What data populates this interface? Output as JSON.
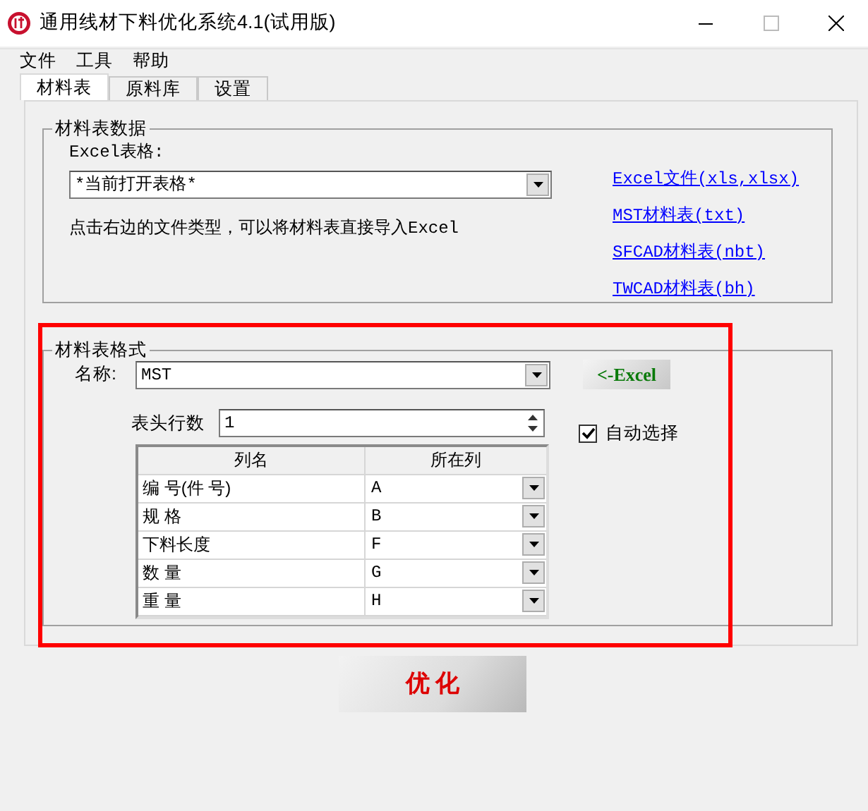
{
  "window": {
    "title": "通用线材下料优化系统4.1(试用版)"
  },
  "menu": [
    "文件",
    "工具",
    "帮助"
  ],
  "tabs": [
    {
      "label": "材料表",
      "selected": true
    },
    {
      "label": "原料库",
      "selected": false
    },
    {
      "label": "设置",
      "selected": false
    }
  ],
  "material_data": {
    "title": "材料表数据",
    "excel_label": "Excel表格:",
    "sheet_select": "*当前打开表格*",
    "hint": "点击右边的文件类型，可以将材料表直接导入Excel",
    "import_links": [
      "Excel文件(xls,xlsx)",
      "MST材料表(txt)",
      "SFCAD材料表(nbt)",
      "TWCAD材料表(bh)"
    ]
  },
  "format": {
    "title": "材料表格式",
    "highlighted": true,
    "name_label": "名称:",
    "name_value": "MST",
    "excel_button": "<-Excel",
    "header_rows_label": "表头行数",
    "header_rows_value": "1",
    "auto_select": {
      "label": "自动选择",
      "checked": true
    },
    "columns": [
      "列名",
      "所在列"
    ],
    "rows": [
      {
        "name": "编 号(件 号)",
        "column": "A"
      },
      {
        "name": "规 格",
        "column": "B"
      },
      {
        "name": "下料长度",
        "column": "F"
      },
      {
        "name": "数 量",
        "column": "G"
      },
      {
        "name": "重 量",
        "column": "H"
      }
    ]
  },
  "optimize_button": "优 化"
}
